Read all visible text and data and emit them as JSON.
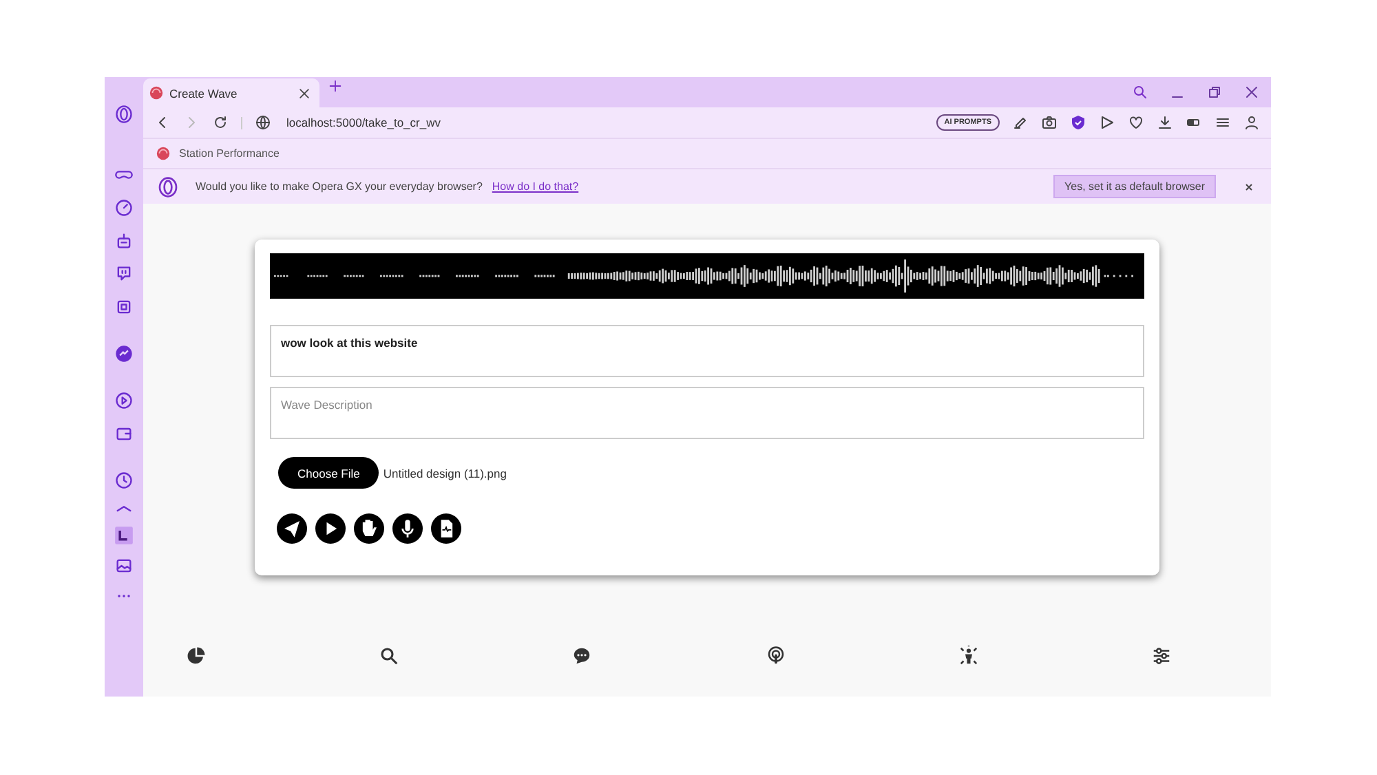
{
  "tab": {
    "title": "Create Wave",
    "selected": true
  },
  "address_bar": {
    "url": "localhost:5000/take_to_cr_wv"
  },
  "toolbar": {
    "ai_button": "AI PROMPTS"
  },
  "bookmarks": [
    {
      "label": "Station Performance"
    }
  ],
  "infobar": {
    "message": "Would you like to make Opera GX your everyday browser?",
    "link": "How do I do that?",
    "button": "Yes, set it as default browser"
  },
  "form": {
    "title_field": {
      "value": "wow look at this website"
    },
    "description_field": {
      "placeholder": "Wave Description"
    },
    "file_button": "Choose File",
    "file_name": "Untitled design (11).png"
  }
}
